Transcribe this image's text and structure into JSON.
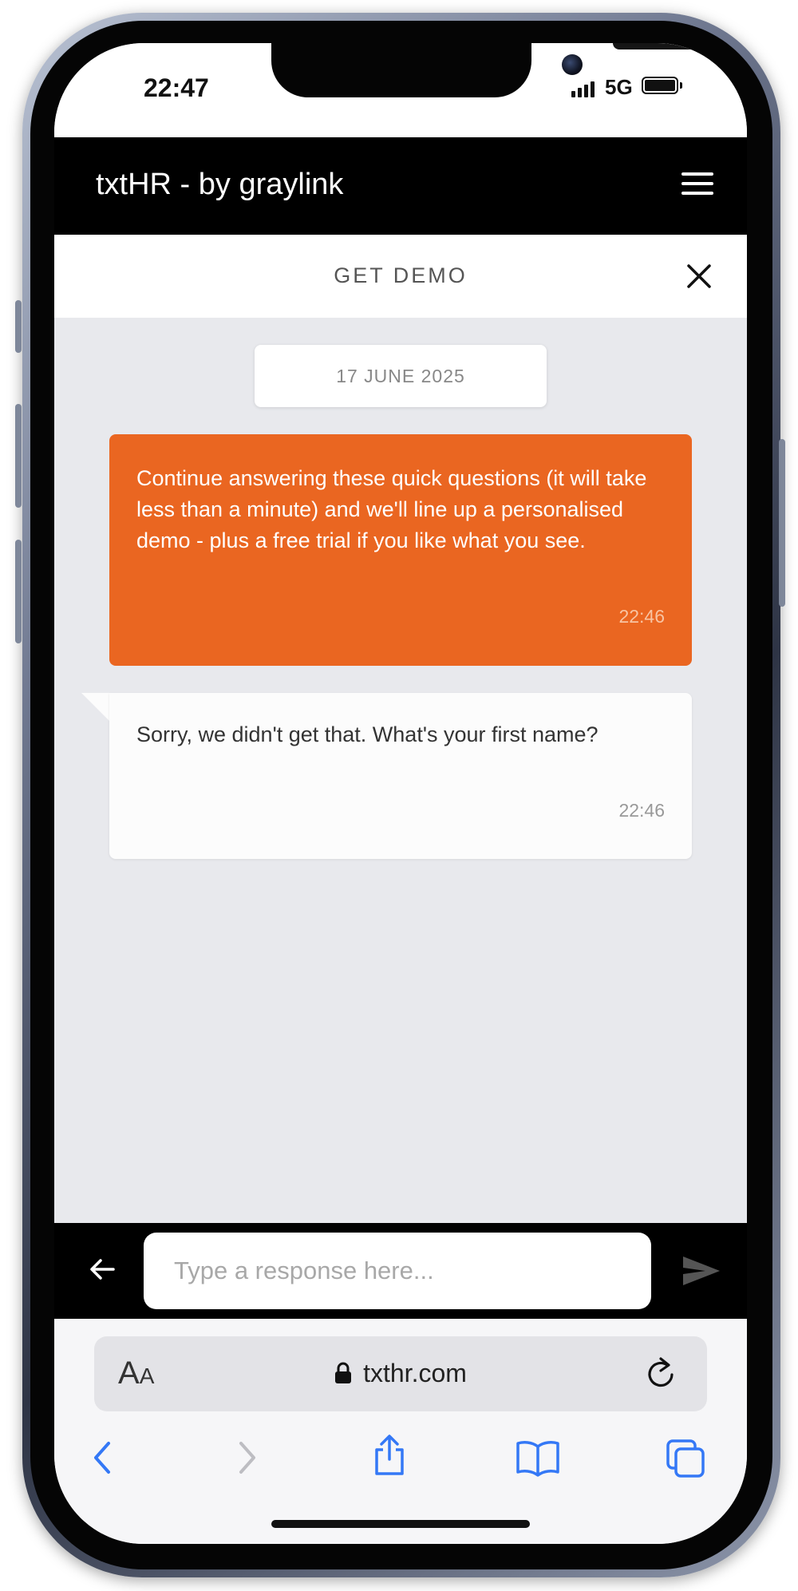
{
  "status_bar": {
    "time": "22:47",
    "network": "5G",
    "battery_level": 1.0
  },
  "app_bar": {
    "title": "txtHR - by graylink",
    "menu_icon": "hamburger-menu-icon"
  },
  "panel": {
    "title": "GET DEMO",
    "close_icon": "close-icon"
  },
  "chat": {
    "date": "17 JUNE 2025",
    "messages": [
      {
        "direction": "outgoing",
        "text": "Continue answering these quick questions (it will take less than a minute) and we'll line up a personalised demo - plus a free trial if you like what you see.",
        "time": "22:46"
      },
      {
        "direction": "incoming",
        "text": "Sorry, we didn't get that. What's your first name?",
        "time": "22:46"
      }
    ]
  },
  "composer": {
    "placeholder": "Type a response here...",
    "value": "",
    "back_icon": "arrow-left-icon",
    "send_icon": "send-icon"
  },
  "browser": {
    "text_size_label_big": "A",
    "text_size_label_small": "A",
    "url": "txthr.com",
    "toolbar_icons": [
      "back-icon",
      "forward-icon",
      "share-icon",
      "bookmarks-icon",
      "tabs-icon"
    ]
  },
  "colors": {
    "accent": "#ea6621",
    "app_bar": "#000000",
    "chat_background": "#e8e9ed",
    "safari_blue": "#3478f6"
  }
}
